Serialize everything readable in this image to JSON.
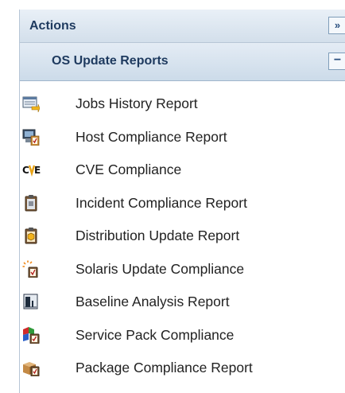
{
  "actions": {
    "title": "Actions",
    "expand_symbol": "»"
  },
  "section": {
    "title": "OS Update Reports",
    "collapse_symbol": "−"
  },
  "items": [
    {
      "label": "Jobs History Report",
      "icon": "jobs-history-icon"
    },
    {
      "label": "Host Compliance Report",
      "icon": "host-compliance-icon"
    },
    {
      "label": "CVE Compliance",
      "icon": "cve-icon"
    },
    {
      "label": "Incident Compliance Report",
      "icon": "incident-clipboard-icon"
    },
    {
      "label": "Distribution Update Report",
      "icon": "distribution-clipboard-icon"
    },
    {
      "label": "Solaris Update Compliance",
      "icon": "solaris-update-icon"
    },
    {
      "label": "Baseline Analysis Report",
      "icon": "baseline-analysis-icon"
    },
    {
      "label": "Service Pack Compliance",
      "icon": "service-pack-icon"
    },
    {
      "label": "Package Compliance Report",
      "icon": "package-compliance-icon"
    }
  ],
  "colors": {
    "header_text": "#1e3a5f",
    "border": "#b7c6d6",
    "item_text": "#222222"
  }
}
